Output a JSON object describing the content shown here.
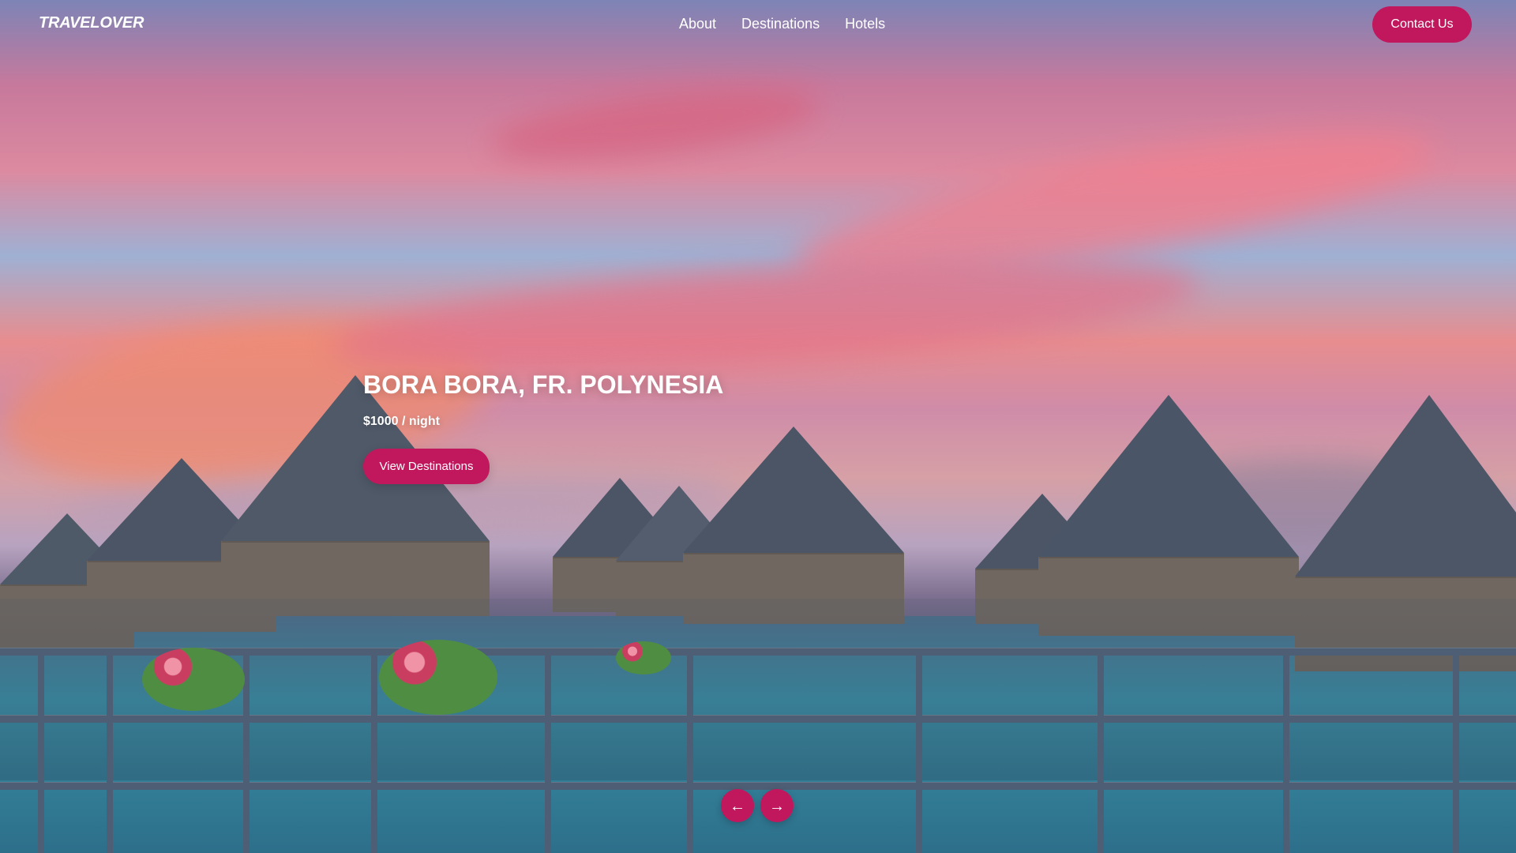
{
  "navigation": {
    "brand": "TRAVELOVER",
    "links": [
      "About",
      "Destinations",
      "Hotels"
    ],
    "contact_label": "Contact Us"
  },
  "hero": {
    "title": "BORA BORA, FR. POLYNESIA",
    "price": "$1000 / night",
    "button_label": "View Destinations"
  },
  "carousel": {
    "previous_icon": "left-arrow-icon",
    "next_icon": "right-arrow-icon",
    "previous_glyph": "←",
    "next_glyph": "→"
  },
  "colors": {
    "accent": "#c1185d"
  }
}
